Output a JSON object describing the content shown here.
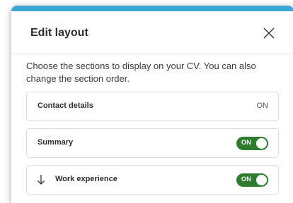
{
  "modal": {
    "title": "Edit layout",
    "intro": "Choose the sections to display on your CV. You can also change the section order."
  },
  "sections": [
    {
      "label": "Contact details",
      "status": "ON"
    },
    {
      "label": "Summary",
      "toggle": "ON"
    },
    {
      "label": "Work experience",
      "toggle": "ON"
    }
  ],
  "icons": {
    "close": "close-icon",
    "drag": "arrow-down-icon"
  },
  "colors": {
    "accent": "#3aa6d6",
    "toggle_on": "#2e7d2e"
  }
}
